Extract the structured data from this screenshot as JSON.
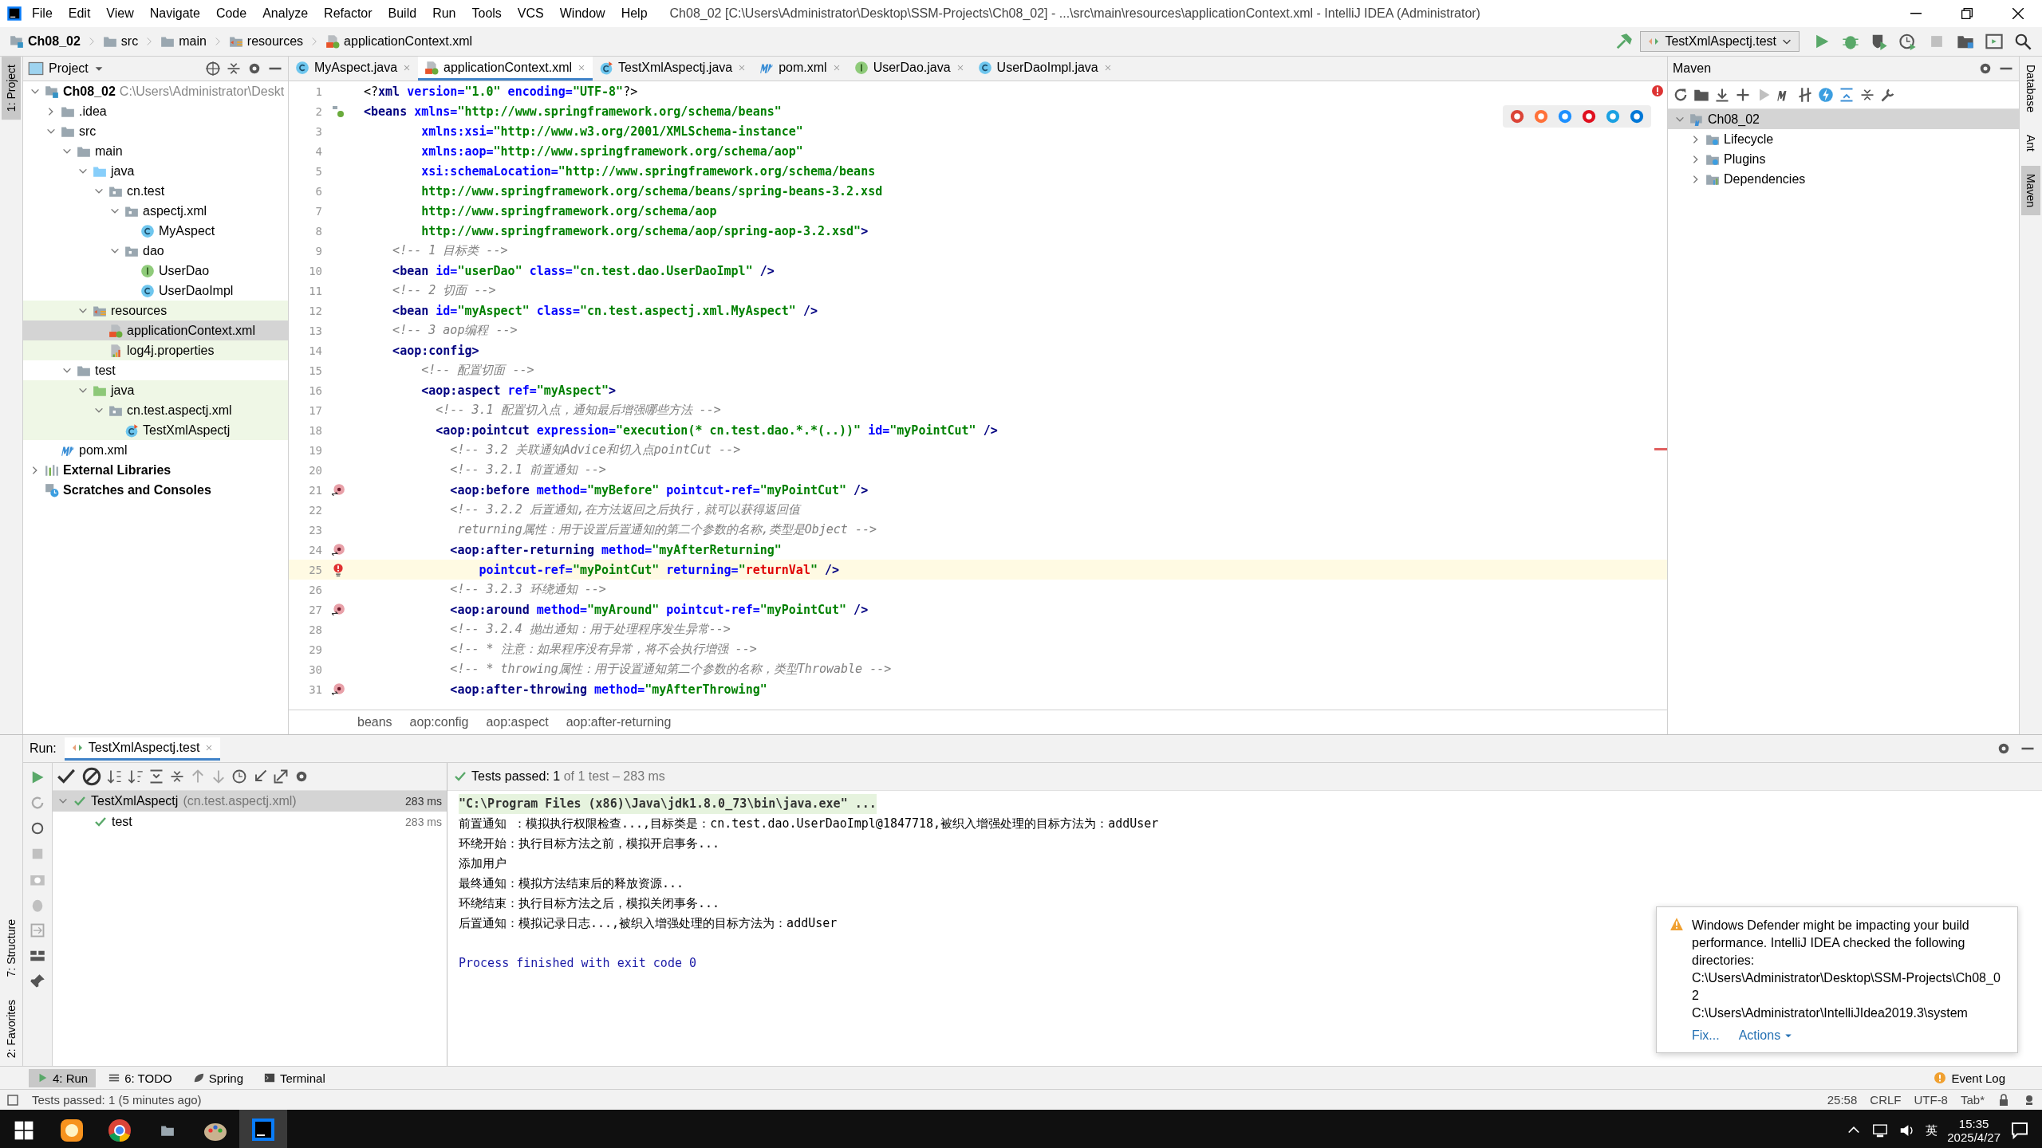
{
  "window": {
    "title": "Ch08_02 [C:\\Users\\Administrator\\Desktop\\SSM-Projects\\Ch08_02] - ...\\src\\main\\resources\\applicationContext.xml - IntelliJ IDEA (Administrator)"
  },
  "menu": [
    "File",
    "Edit",
    "View",
    "Navigate",
    "Code",
    "Analyze",
    "Refactor",
    "Build",
    "Run",
    "Tools",
    "VCS",
    "Window",
    "Help"
  ],
  "breadcrumb": [
    {
      "label": "Ch08_02",
      "kind": "module"
    },
    {
      "label": "src",
      "kind": "folder"
    },
    {
      "label": "main",
      "kind": "folder"
    },
    {
      "label": "resources",
      "kind": "resources"
    },
    {
      "label": "applicationContext.xml",
      "kind": "xml"
    }
  ],
  "run_config": "TestXmlAspectj.test",
  "left_stripe": [
    {
      "label": "1: Project",
      "selected": true
    },
    {
      "label": "7: Structure",
      "selected": false
    },
    {
      "label": "2: Favorites",
      "selected": false
    }
  ],
  "right_stripe": [
    {
      "label": "Database",
      "selected": false
    },
    {
      "label": "Ant",
      "selected": false
    },
    {
      "label": "Maven",
      "selected": true
    }
  ],
  "project": {
    "title": "Project",
    "tree": [
      {
        "label": "Ch08_02",
        "note": "C:\\Users\\Administrator\\Deskt",
        "kind": "module",
        "expanded": true,
        "selected": false,
        "tinted": false,
        "children": [
          {
            "label": ".idea",
            "kind": "folder",
            "expanded": false,
            "selected": false,
            "tinted": false
          },
          {
            "label": "src",
            "kind": "folder",
            "expanded": true,
            "selected": false,
            "tinted": false,
            "children": [
              {
                "label": "main",
                "kind": "folder",
                "expanded": true,
                "selected": false,
                "tinted": false,
                "children": [
                  {
                    "label": "java",
                    "kind": "source",
                    "expanded": true,
                    "selected": false,
                    "tinted": false,
                    "children": [
                      {
                        "label": "cn.test",
                        "kind": "package",
                        "expanded": true,
                        "selected": false,
                        "tinted": false,
                        "children": [
                          {
                            "label": "aspectj.xml",
                            "kind": "package",
                            "expanded": true,
                            "selected": false,
                            "tinted": false,
                            "children": [
                              {
                                "label": "MyAspect",
                                "kind": "class",
                                "selected": false,
                                "tinted": false
                              }
                            ]
                          },
                          {
                            "label": "dao",
                            "kind": "package",
                            "expanded": true,
                            "selected": false,
                            "tinted": false,
                            "children": [
                              {
                                "label": "UserDao",
                                "kind": "interface",
                                "selected": false,
                                "tinted": false
                              },
                              {
                                "label": "UserDaoImpl",
                                "kind": "class",
                                "selected": false,
                                "tinted": false
                              }
                            ]
                          }
                        ]
                      }
                    ]
                  },
                  {
                    "label": "resources",
                    "kind": "resources",
                    "expanded": true,
                    "selected": false,
                    "tinted": true,
                    "children": [
                      {
                        "label": "applicationContext.xml",
                        "kind": "xml",
                        "selected": true,
                        "tinted": true
                      },
                      {
                        "label": "log4j.properties",
                        "kind": "properties",
                        "selected": false,
                        "tinted": true
                      }
                    ]
                  }
                ]
              },
              {
                "label": "test",
                "kind": "folder",
                "expanded": true,
                "selected": false,
                "tinted": false,
                "children": [
                  {
                    "label": "java",
                    "kind": "testsource",
                    "expanded": true,
                    "selected": false,
                    "tinted": true,
                    "children": [
                      {
                        "label": "cn.test.aspectj.xml",
                        "kind": "package",
                        "expanded": true,
                        "selected": false,
                        "tinted": true,
                        "children": [
                          {
                            "label": "TestXmlAspectj",
                            "kind": "testclass",
                            "selected": false,
                            "tinted": true
                          }
                        ]
                      }
                    ]
                  }
                ]
              }
            ]
          },
          {
            "label": "pom.xml",
            "kind": "maven",
            "selected": false,
            "tinted": false
          }
        ]
      },
      {
        "label": "External Libraries",
        "kind": "libraries",
        "expanded": false,
        "selected": false,
        "tinted": false
      },
      {
        "label": "Scratches and Consoles",
        "kind": "scratches",
        "selected": false,
        "tinted": false
      }
    ]
  },
  "tabs": [
    {
      "label": "MyAspect.java",
      "kind": "class",
      "selected": false
    },
    {
      "label": "applicationContext.xml",
      "kind": "xml",
      "selected": true
    },
    {
      "label": "TestXmlAspectj.java",
      "kind": "testclass",
      "selected": false
    },
    {
      "label": "pom.xml",
      "kind": "maven",
      "selected": false
    },
    {
      "label": "UserDao.java",
      "kind": "interface",
      "selected": false
    },
    {
      "label": "UserDaoImpl.java",
      "kind": "class",
      "selected": false
    }
  ],
  "editor": {
    "lines": [
      {
        "number": "1",
        "kind": "plain",
        "current": false,
        "segments": [
          {
            "kind": "plain",
            "text": "<?"
          },
          {
            "kind": "tag",
            "text": "xml"
          },
          {
            "kind": "attr",
            "text": " version="
          },
          {
            "kind": "value",
            "text": "\"1.0\""
          },
          {
            "kind": "attr",
            "text": " encoding="
          },
          {
            "kind": "value",
            "text": "\"UTF-8\""
          },
          {
            "kind": "plain",
            "text": "?>"
          }
        ]
      },
      {
        "number": "2",
        "kind": "bean",
        "current": false,
        "segments": [
          {
            "kind": "tag",
            "text": "<beans"
          },
          {
            "kind": "attr",
            "text": " xmlns="
          },
          {
            "kind": "value",
            "text": "\"http://www.springframework.org/schema/beans\""
          }
        ]
      },
      {
        "number": "3",
        "kind": "plain",
        "current": false,
        "segments": [
          {
            "kind": "attr",
            "text": "        xmlns:xsi="
          },
          {
            "kind": "value",
            "text": "\"http://www.w3.org/2001/XMLSchema-instance\""
          }
        ]
      },
      {
        "number": "4",
        "kind": "plain",
        "current": false,
        "segments": [
          {
            "kind": "attr",
            "text": "        xmlns:aop="
          },
          {
            "kind": "value",
            "text": "\"http://www.springframework.org/schema/aop\""
          }
        ]
      },
      {
        "number": "5",
        "kind": "plain",
        "current": false,
        "segments": [
          {
            "kind": "attr",
            "text": "        xsi:schemaLocation="
          },
          {
            "kind": "value",
            "text": "\"http://www.springframework.org/schema/beans"
          }
        ]
      },
      {
        "number": "6",
        "kind": "plain",
        "current": false,
        "segments": [
          {
            "kind": "value",
            "text": "        http://www.springframework.org/schema/beans/spring-beans-3.2.xsd"
          }
        ]
      },
      {
        "number": "7",
        "kind": "plain",
        "current": false,
        "segments": [
          {
            "kind": "value",
            "text": "        http://www.springframework.org/schema/aop"
          }
        ]
      },
      {
        "number": "8",
        "kind": "plain",
        "current": false,
        "segments": [
          {
            "kind": "value",
            "text": "        http://www.springframework.org/schema/aop/spring-aop-3.2.xsd\""
          },
          {
            "kind": "tag",
            "text": ">"
          }
        ]
      },
      {
        "number": "9",
        "kind": "plain",
        "current": false,
        "segments": [
          {
            "kind": "comment",
            "text": "    <!-- 1 目标类 -->"
          }
        ]
      },
      {
        "number": "10",
        "kind": "plain",
        "current": false,
        "segments": [
          {
            "kind": "tag",
            "text": "    <bean"
          },
          {
            "kind": "attr",
            "text": " id="
          },
          {
            "kind": "value",
            "text": "\"userDao\""
          },
          {
            "kind": "attr",
            "text": " class="
          },
          {
            "kind": "value",
            "text": "\"cn.test.dao.UserDaoImpl\""
          },
          {
            "kind": "tag",
            "text": " />"
          }
        ]
      },
      {
        "number": "11",
        "kind": "plain",
        "current": false,
        "segments": [
          {
            "kind": "comment",
            "text": "    <!-- 2 切面 -->"
          }
        ]
      },
      {
        "number": "12",
        "kind": "plain",
        "current": false,
        "segments": [
          {
            "kind": "tag",
            "text": "    <bean"
          },
          {
            "kind": "attr",
            "text": " id="
          },
          {
            "kind": "value",
            "text": "\"myAspect\""
          },
          {
            "kind": "attr",
            "text": " class="
          },
          {
            "kind": "value",
            "text": "\"cn.test.aspectj.xml.MyAspect\""
          },
          {
            "kind": "tag",
            "text": " />"
          }
        ]
      },
      {
        "number": "13",
        "kind": "plain",
        "current": false,
        "segments": [
          {
            "kind": "comment",
            "text": "    <!-- 3 aop编程 -->"
          }
        ]
      },
      {
        "number": "14",
        "kind": "plain",
        "current": false,
        "segments": [
          {
            "kind": "tag",
            "text": "    <aop:config>"
          }
        ]
      },
      {
        "number": "15",
        "kind": "plain",
        "current": false,
        "segments": [
          {
            "kind": "comment",
            "text": "        <!-- 配置切面 -->"
          }
        ]
      },
      {
        "number": "16",
        "kind": "plain",
        "current": false,
        "segments": [
          {
            "kind": "tag",
            "text": "        <aop:aspect"
          },
          {
            "kind": "attr",
            "text": " ref="
          },
          {
            "kind": "value",
            "text": "\"myAspect\""
          },
          {
            "kind": "tag",
            "text": ">"
          }
        ]
      },
      {
        "number": "17",
        "kind": "plain",
        "current": false,
        "segments": [
          {
            "kind": "comment",
            "text": "          <!-- 3.1 配置切入点，通知最后增强哪些方法 -->"
          }
        ]
      },
      {
        "number": "18",
        "kind": "plain",
        "current": false,
        "segments": [
          {
            "kind": "tag",
            "text": "          <aop:pointcut"
          },
          {
            "kind": "attr",
            "text": " expression="
          },
          {
            "kind": "value",
            "text": "\"execution(* cn.test.dao.*.*(..))\""
          },
          {
            "kind": "attr",
            "text": " id="
          },
          {
            "kind": "value",
            "text": "\"myPointCut\""
          },
          {
            "kind": "tag",
            "text": " />"
          }
        ]
      },
      {
        "number": "19",
        "kind": "plain",
        "current": false,
        "segments": [
          {
            "kind": "comment",
            "text": "            <!-- 3.2 关联通知Advice和切入点pointCut -->"
          }
        ]
      },
      {
        "number": "20",
        "kind": "plain",
        "current": false,
        "segments": [
          {
            "kind": "comment",
            "text": "            <!-- 3.2.1 前置通知 -->"
          }
        ]
      },
      {
        "number": "21",
        "kind": "advice",
        "current": false,
        "segments": [
          {
            "kind": "tag",
            "text": "            <aop:before"
          },
          {
            "kind": "attr",
            "text": " method="
          },
          {
            "kind": "value",
            "text": "\"myBefore\""
          },
          {
            "kind": "attr",
            "text": " pointcut-ref="
          },
          {
            "kind": "value",
            "text": "\"myPointCut\""
          },
          {
            "kind": "tag",
            "text": " />"
          }
        ]
      },
      {
        "number": "22",
        "kind": "plain",
        "current": false,
        "segments": [
          {
            "kind": "comment",
            "text": "            <!-- 3.2.2 后置通知,在方法返回之后执行，就可以获得返回值"
          }
        ]
      },
      {
        "number": "23",
        "kind": "plain",
        "current": false,
        "segments": [
          {
            "kind": "comment",
            "text": "             returning属性：用于设置后置通知的第二个参数的名称,类型是Object -->"
          }
        ]
      },
      {
        "number": "24",
        "kind": "advice",
        "current": false,
        "segments": [
          {
            "kind": "tag",
            "text": "            <aop:after-returning"
          },
          {
            "kind": "attr",
            "text": " method="
          },
          {
            "kind": "value",
            "text": "\"myAfterReturning\""
          }
        ]
      },
      {
        "number": "25",
        "kind": "error",
        "current": true,
        "segments": [
          {
            "kind": "attr",
            "text": "                pointcut-ref="
          },
          {
            "kind": "value",
            "text": "\"myPointCut\""
          },
          {
            "kind": "attr",
            "text": " returning="
          },
          {
            "kind": "value",
            "text": "\""
          },
          {
            "kind": "error",
            "text": "returnVal"
          },
          {
            "kind": "value",
            "text": "\""
          },
          {
            "kind": "tag",
            "text": " />"
          }
        ]
      },
      {
        "number": "26",
        "kind": "plain",
        "current": false,
        "segments": [
          {
            "kind": "comment",
            "text": "            <!-- 3.2.3 环绕通知 -->"
          }
        ]
      },
      {
        "number": "27",
        "kind": "advice",
        "current": false,
        "segments": [
          {
            "kind": "tag",
            "text": "            <aop:around"
          },
          {
            "kind": "attr",
            "text": " method="
          },
          {
            "kind": "value",
            "text": "\"myAround\""
          },
          {
            "kind": "attr",
            "text": " pointcut-ref="
          },
          {
            "kind": "value",
            "text": "\"myPointCut\""
          },
          {
            "kind": "tag",
            "text": " />"
          }
        ]
      },
      {
        "number": "28",
        "kind": "plain",
        "current": false,
        "segments": [
          {
            "kind": "comment",
            "text": "            <!-- 3.2.4 抛出通知：用于处理程序发生异常-->"
          }
        ]
      },
      {
        "number": "29",
        "kind": "plain",
        "current": false,
        "segments": [
          {
            "kind": "comment",
            "text": "            <!-- * 注意：如果程序没有异常，将不会执行增强 -->"
          }
        ]
      },
      {
        "number": "30",
        "kind": "plain",
        "current": false,
        "segments": [
          {
            "kind": "comment",
            "text": "            <!-- * throwing属性：用于设置通知第二个参数的名称，类型Throwable -->"
          }
        ]
      },
      {
        "number": "31",
        "kind": "advice",
        "current": false,
        "segments": [
          {
            "kind": "tag",
            "text": "            <aop:after-throwing"
          },
          {
            "kind": "attr",
            "text": " method="
          },
          {
            "kind": "value",
            "text": "\"myAfterThrowing\""
          }
        ]
      }
    ],
    "path": [
      "beans",
      "aop:config",
      "aop:aspect",
      "aop:after-returning"
    ]
  },
  "maven": {
    "title": "Maven",
    "tree": [
      {
        "label": "Ch08_02",
        "kind": "maven-module",
        "expanded": true,
        "selected": true,
        "children": [
          {
            "label": "Lifecycle",
            "kind": "maven-folder",
            "expanded": false,
            "selected": false
          },
          {
            "label": "Plugins",
            "kind": "maven-folder",
            "expanded": false,
            "selected": false
          },
          {
            "label": "Dependencies",
            "kind": "deps-folder",
            "expanded": false,
            "selected": false
          }
        ]
      }
    ]
  },
  "run": {
    "label": "Run:",
    "tab": "TestXmlAspectj.test",
    "status": {
      "prefix": "Tests passed: ",
      "count": "1",
      "rest": " of 1 test – 283 ms"
    },
    "tests": [
      {
        "name": "TestXmlAspectj",
        "detail": "(cn.test.aspectj.xml)",
        "time": "283 ms",
        "selected": true,
        "children": [
          {
            "name": "test",
            "time": "283 ms",
            "selected": false
          }
        ]
      }
    ],
    "console": [
      {
        "kind": "command",
        "text": "\"C:\\Program Files (x86)\\Java\\jdk1.8.0_73\\bin\\java.exe\" ..."
      },
      {
        "kind": "output",
        "text": "前置通知 ：模拟执行权限检查...,目标类是：cn.test.dao.UserDaoImpl@1847718,被织入增强处理的目标方法为：addUser"
      },
      {
        "kind": "output",
        "text": "环绕开始：执行目标方法之前，模拟开启事务..."
      },
      {
        "kind": "output",
        "text": "添加用户"
      },
      {
        "kind": "output",
        "text": "最终通知：模拟方法结束后的释放资源..."
      },
      {
        "kind": "output",
        "text": "环绕结束：执行目标方法之后，模拟关闭事务..."
      },
      {
        "kind": "output",
        "text": "后置通知：模拟记录日志...,被织入增强处理的目标方法为：addUser"
      },
      {
        "kind": "exit",
        "text": "Process finished with exit code 0"
      }
    ]
  },
  "notification": {
    "text": "Windows Defender might be impacting your build performance. IntelliJ IDEA checked the following directories:",
    "paths": [
      "C:\\Users\\Administrator\\Desktop\\SSM-Projects\\Ch08_02",
      "C:\\Users\\Administrator\\IntelliJIdea2019.3\\system"
    ],
    "actions": [
      "Fix...",
      "Actions"
    ]
  },
  "tool_windows": [
    {
      "label": "4: Run",
      "kind": "run",
      "selected": true
    },
    {
      "label": "6: TODO",
      "kind": "list",
      "selected": false
    },
    {
      "label": "Spring",
      "kind": "leaf",
      "selected": false
    },
    {
      "label": "Terminal",
      "kind": "terminal",
      "selected": false
    }
  ],
  "event_log": "Event Log",
  "status_bar": {
    "message": "Tests passed: 1 (5 minutes ago)",
    "items": [
      "25:58",
      "CRLF",
      "UTF-8",
      "Tab*"
    ]
  },
  "taskbar": {
    "apps": [
      {
        "kind": "app",
        "selected": false
      },
      {
        "kind": "browser",
        "selected": false
      },
      {
        "kind": "folder",
        "selected": false
      },
      {
        "kind": "palette",
        "selected": false
      },
      {
        "kind": "ide",
        "selected": true
      }
    ],
    "ime": "英",
    "time": "15:35",
    "date": "2025/4/27"
  }
}
